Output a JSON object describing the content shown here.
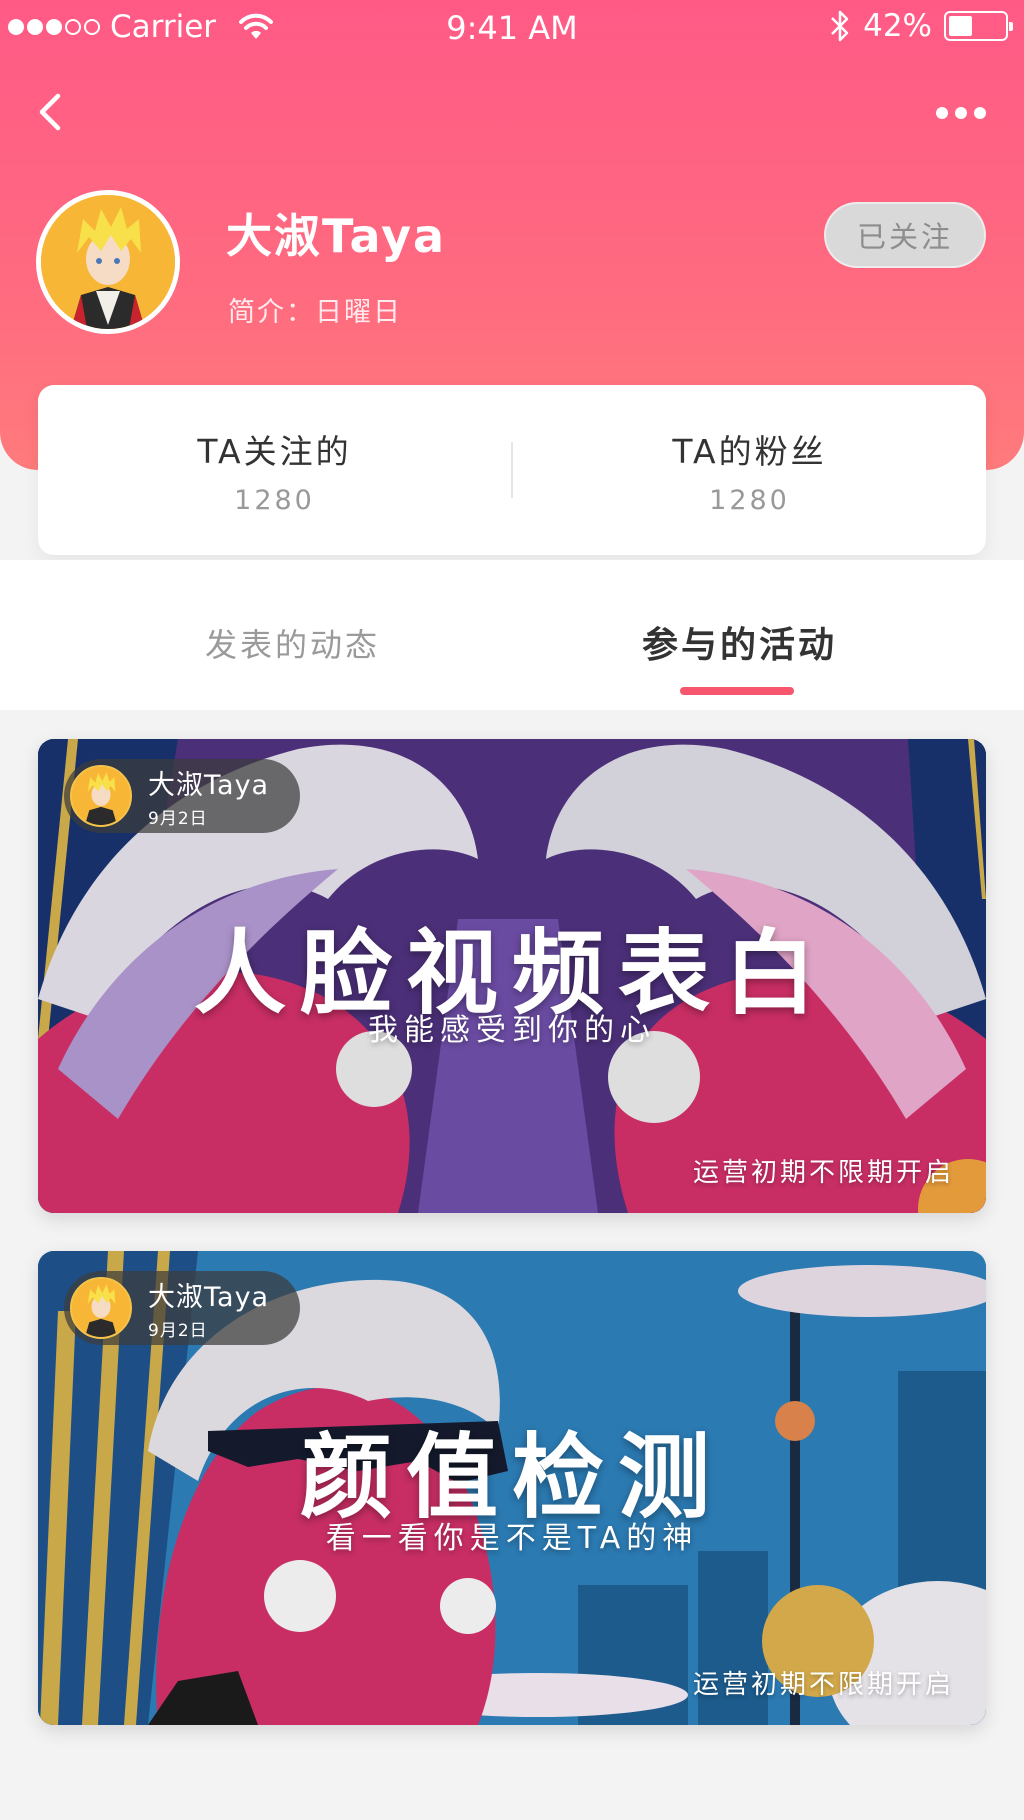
{
  "status_bar": {
    "carrier": "Carrier",
    "time": "9:41 AM",
    "battery": "42%",
    "battery_level": 0.42,
    "signal_bars_filled": 3,
    "signal_bars_total": 5
  },
  "nav": {
    "back_icon": "chevron-left-icon",
    "more_icon": "more-horizontal-icon"
  },
  "profile": {
    "name": "大淑Taya",
    "bio": "简介：日曜日",
    "follow_label": "已关注"
  },
  "stats": [
    {
      "label": "TA关注的",
      "value": "1280"
    },
    {
      "label": "TA的粉丝",
      "value": "1280"
    }
  ],
  "tabs": [
    {
      "label": "发表的动态",
      "active": false
    },
    {
      "label": "参与的活动",
      "active": true
    }
  ],
  "activities": [
    {
      "author": "大淑Taya",
      "date": "9月2日",
      "title": "人脸视频表白",
      "subtitle": "我能感受到你的心",
      "footer": "运营初期不限期开启"
    },
    {
      "author": "大淑Taya",
      "date": "9月2日",
      "title": "颜值检测",
      "subtitle": "看一看你是不是TA的神",
      "footer": "运营初期不限期开启"
    }
  ],
  "colors": {
    "header_gradient_top": "#ff5a86",
    "header_gradient_bottom": "#ff7b7c",
    "tab_indicator": "#f7566e",
    "follow_button_bg": "#d9d9d9"
  }
}
